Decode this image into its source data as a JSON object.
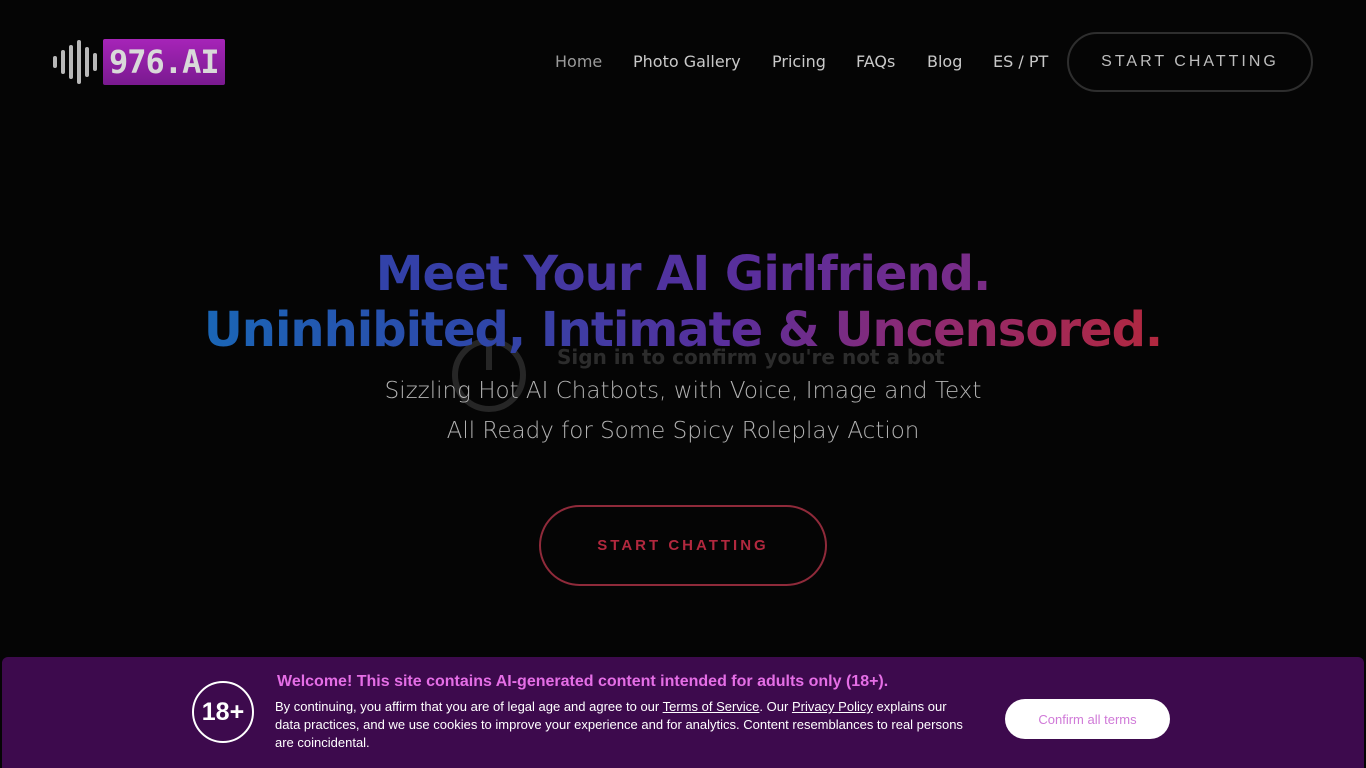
{
  "brand": {
    "logo_text": "976.AI"
  },
  "nav": {
    "items": [
      "Home",
      "Photo Gallery",
      "Pricing",
      "FAQs",
      "Blog",
      "ES / PT"
    ],
    "cta": "START CHATTING"
  },
  "hero": {
    "title_line1": "Meet Your AI Girlfriend.",
    "title_line2": "Uninhibited, Intimate & Uncensored.",
    "overlay_text": "Sign in to confirm you're not a bot",
    "subtitle_line1": "Sizzling Hot AI Chatbots, with Voice, Image and Text",
    "subtitle_line2": "All Ready for Some Spicy Roleplay Action",
    "cta": "START CHATTING"
  },
  "banner": {
    "badge": "18+",
    "title": "Welcome! This site contains AI-generated content intended for adults only (18+).",
    "text_before_tos": "By continuing, you affirm that you are of legal age and agree to our ",
    "tos_link": "Terms of Service",
    "text_mid": ". Our ",
    "privacy_link": "Privacy Policy",
    "text_after": " explains our data practices, and we use cookies to improve your experience and for analytics. Content resemblances to real persons are coincidental.",
    "confirm_button": "Confirm all terms"
  },
  "colors": {
    "background": "#050505",
    "banner_bg": "#3d0a4d",
    "banner_title": "#e56ee6",
    "cta_border": "#8f2a3a",
    "logo_bg": "#a624b8"
  }
}
